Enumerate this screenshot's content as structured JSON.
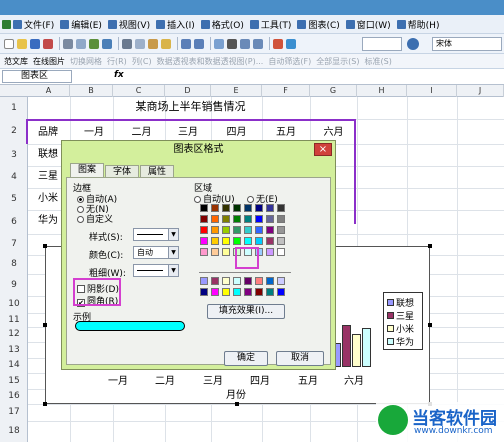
{
  "menu": [
    "文件(F)",
    "编辑(E)",
    "视图(V)",
    "插入(I)",
    "格式(O)",
    "工具(T)",
    "图表(C)",
    "窗口(W)",
    "帮助(H)"
  ],
  "menu_icon_color": "#3d6fb0",
  "toolbar": {
    "font": "宋体",
    "items2": [
      "范文库",
      "在线图片",
      "切换网格",
      "行(R)",
      "列(C)",
      "数据透视表和数据透视图(P)...",
      "自动筛选(F)",
      "全部显示(S)",
      "标准(S)"
    ]
  },
  "namebox": "图表区",
  "fx": "fx",
  "columns": [
    "A",
    "B",
    "C",
    "D",
    "E",
    "F",
    "G",
    "H",
    "I",
    "J"
  ],
  "rows": [
    "1",
    "2",
    "3",
    "4",
    "5",
    "6",
    "7",
    "8",
    "9",
    "10",
    "11",
    "12",
    "13",
    "14",
    "15",
    "16",
    "17",
    "18"
  ],
  "sheet": {
    "title": "某商场上半年销售情况",
    "header": [
      "品牌",
      "一月",
      "二月",
      "三月",
      "四月",
      "五月",
      "六月"
    ],
    "brands": [
      "联想",
      "三星",
      "小米",
      "华为"
    ]
  },
  "chart": {
    "months": [
      "一月",
      "二月",
      "三月",
      "四月",
      "五月",
      "六月"
    ],
    "xaxis_title": "月份",
    "legend": [
      "联想",
      "三星",
      "小米",
      "华为"
    ],
    "colors": [
      "#9999ff",
      "#993366",
      "#ffffcc",
      "#ccffff"
    ]
  },
  "dialog": {
    "title": "图表区格式",
    "close": "×",
    "tabs": [
      "图案",
      "字体",
      "属性"
    ],
    "border_group": "边框",
    "border_options": [
      "自动(A)",
      "无(N)",
      "自定义"
    ],
    "style_label": "样式(S):",
    "color_label": "颜色(C):",
    "color_value": "自动",
    "weight_label": "粗细(W):",
    "shadow": "阴影(D)",
    "rounded": "圆角(R)",
    "check_mark": "✔",
    "sample": "示例",
    "area_group": "区域",
    "area_options": [
      "自动(U)",
      "无(E)"
    ],
    "fill_effects": "填充效果(I)...",
    "ok": "确定",
    "cancel": "取消",
    "palette": [
      "#000000",
      "#993300",
      "#333300",
      "#003300",
      "#003366",
      "#000080",
      "#333399",
      "#333333",
      "#800000",
      "#ff6600",
      "#808000",
      "#008000",
      "#008080",
      "#0000ff",
      "#666699",
      "#808080",
      "#ff0000",
      "#ff9900",
      "#99cc00",
      "#339966",
      "#33cccc",
      "#3366ff",
      "#800080",
      "#969696",
      "#ff00ff",
      "#ffcc00",
      "#ffff00",
      "#00ff00",
      "#00ffff",
      "#00ccff",
      "#993366",
      "#c0c0c0",
      "#ff99cc",
      "#ffcc99",
      "#ffff99",
      "#ccffcc",
      "#ccffff",
      "#99ccff",
      "#cc99ff",
      "#ffffff"
    ],
    "palette2": [
      "#9999ff",
      "#993366",
      "#ffffcc",
      "#ccffff",
      "#660066",
      "#ff8080",
      "#0066cc",
      "#ccccff",
      "#000080",
      "#ff00ff",
      "#ffff00",
      "#00ffff",
      "#800080",
      "#800000",
      "#008080",
      "#0000ff"
    ],
    "sample_color": "#00ffff"
  },
  "watermark": {
    "name": "当客软件园",
    "url": "www.downkr.com"
  }
}
